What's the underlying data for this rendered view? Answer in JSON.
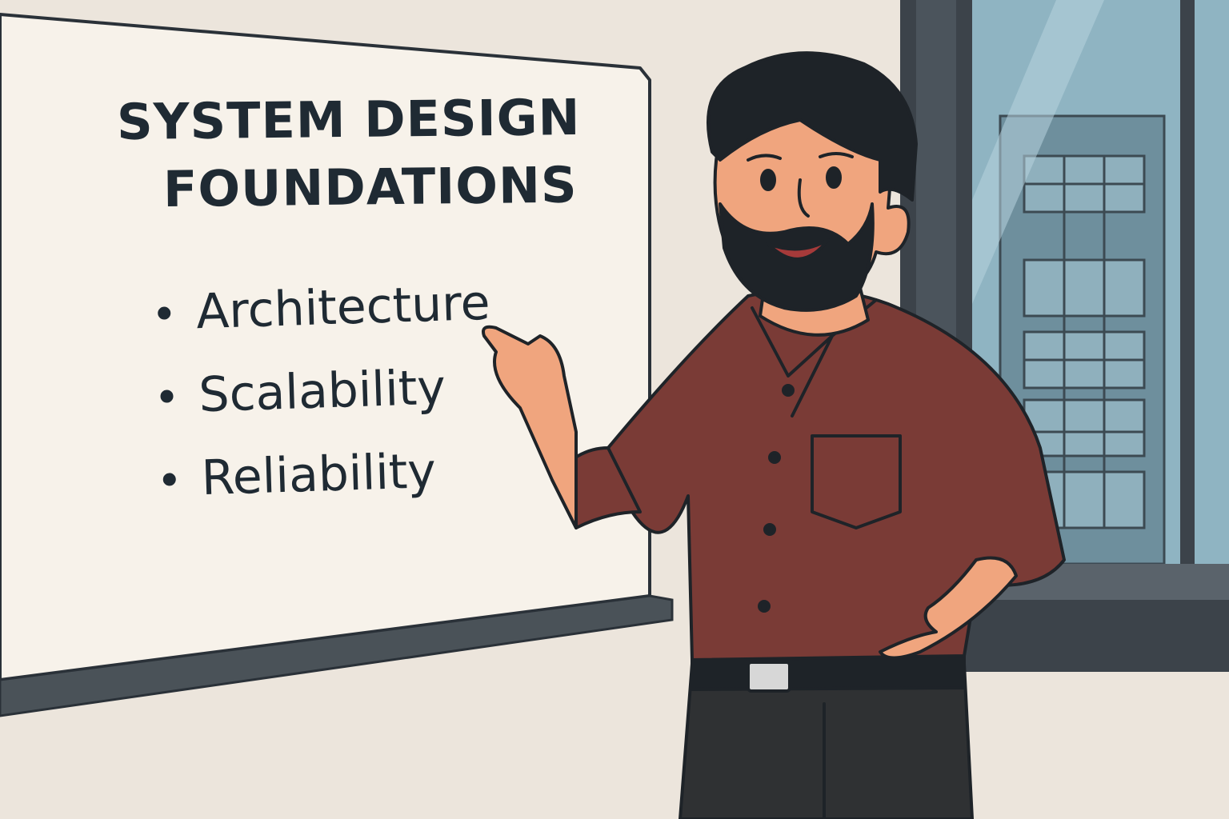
{
  "board": {
    "title_line_1": "SYSTEM DESIGN",
    "title_line_2": "FOUNDATIONS",
    "bullets": [
      "Architecture",
      "Scalability",
      "Reliability"
    ]
  },
  "colors": {
    "wall": "#ece5dc",
    "board_surface": "#f7f2ea",
    "board_tray": "#4a5258",
    "text": "#1f2a33",
    "shirt": "#7a3b36",
    "skin": "#f0a57e",
    "hair": "#1e2328",
    "pants": "#2f3133",
    "window_frame": "#3c434a",
    "window_glass": "#8fb4c2",
    "building": "#6e8f9d"
  },
  "icons": [
    "bullet-dot-icon",
    "belt-buckle-icon",
    "shirt-button-icon"
  ]
}
